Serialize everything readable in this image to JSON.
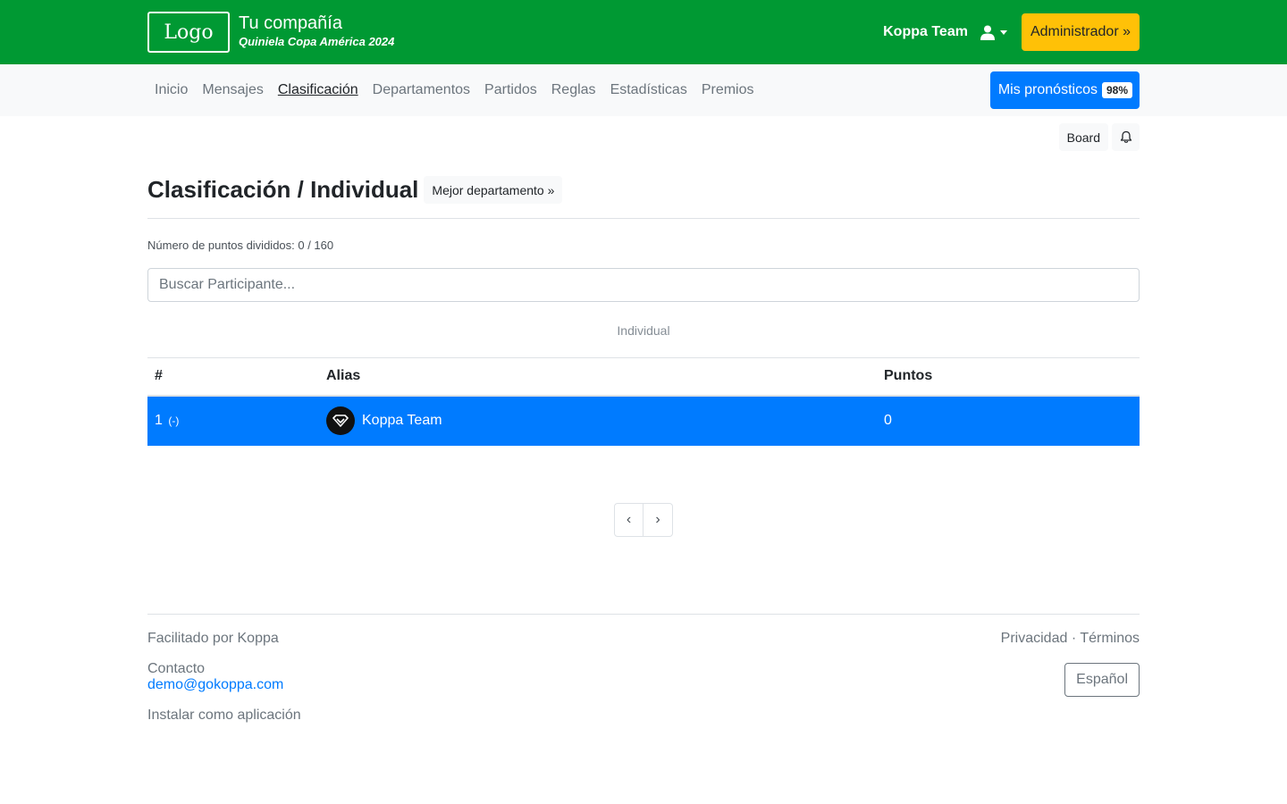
{
  "header": {
    "logo_text": "Logo",
    "company_name": "Tu compañía",
    "subtitle": "Quiniela Copa América 2024",
    "user_name": "Koppa Team",
    "user_icon": "user-icon",
    "admin_label": "Administrador »"
  },
  "nav": {
    "items": [
      {
        "label": "Inicio"
      },
      {
        "label": "Mensajes"
      },
      {
        "label": "Clasificación"
      },
      {
        "label": "Departamentos"
      },
      {
        "label": "Partidos"
      },
      {
        "label": "Reglas"
      },
      {
        "label": "Estadísticas"
      },
      {
        "label": "Premios"
      }
    ],
    "active": "Clasificación",
    "predictions_label": "Mis pronósticos",
    "predictions_badge": "98%"
  },
  "toolbar": {
    "board_label": "Board",
    "bell_icon": "bell-icon"
  },
  "page": {
    "title": "Clasificación / Individual",
    "best_department_label": "Mejor departamento »",
    "points_info": "Número de puntos divididos: 0 / 160",
    "search_placeholder": "Buscar Participante...",
    "section_label": "Individual"
  },
  "table": {
    "columns": [
      "#",
      "Alias",
      "Puntos"
    ],
    "rows": [
      {
        "rank": "1",
        "change": "(-)",
        "alias": "Koppa Team",
        "points": "0"
      }
    ]
  },
  "pagination": {
    "prev": "‹",
    "next": "›"
  },
  "footer": {
    "powered_by": "Facilitado por Koppa",
    "contact_label": "Contacto",
    "contact_email": "demo@gokoppa.com",
    "install_label": "Instalar como aplicación",
    "privacy_label": "Privacidad",
    "separator": "·",
    "terms_label": "Términos",
    "language_label": "Español"
  },
  "colors": {
    "header_bg": "#009933",
    "admin_bg": "#ffc107",
    "primary": "#007bff",
    "nav_bg": "#f8f9fa"
  }
}
